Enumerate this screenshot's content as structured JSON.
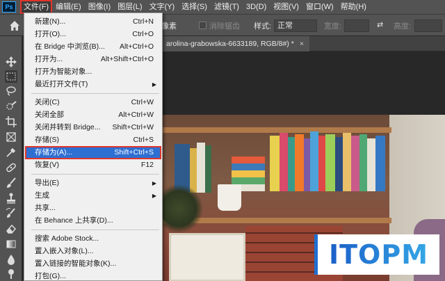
{
  "menubar": {
    "logo": "Ps",
    "items": [
      "文件(F)",
      "编辑(E)",
      "图像(I)",
      "图层(L)",
      "文字(Y)",
      "选择(S)",
      "滤镜(T)",
      "3D(D)",
      "视图(V)",
      "窗口(W)",
      "帮助(H)"
    ]
  },
  "options": {
    "unit": "像素",
    "antialias": "消除锯齿",
    "style_label": "样式:",
    "style_value": "正常",
    "width_label": "宽度:",
    "height_label": "高度:"
  },
  "document_tab": {
    "title": "arolina-grabowska-6633189, RGB/8#) *",
    "close": "×"
  },
  "file_menu": {
    "items": [
      {
        "label": "新建(N)...",
        "shortcut": "Ctrl+N"
      },
      {
        "label": "打开(O)...",
        "shortcut": "Ctrl+O"
      },
      {
        "label": "在 Bridge 中浏览(B)...",
        "shortcut": "Alt+Ctrl+O"
      },
      {
        "label": "打开为...",
        "shortcut": "Alt+Shift+Ctrl+O"
      },
      {
        "label": "打开为智能对象...",
        "shortcut": ""
      },
      {
        "label": "最近打开文件(T)",
        "shortcut": "",
        "submenu": true
      },
      {
        "label": "关闭(C)",
        "shortcut": "Ctrl+W"
      },
      {
        "label": "关闭全部",
        "shortcut": "Alt+Ctrl+W"
      },
      {
        "label": "关闭并转到 Bridge...",
        "shortcut": "Shift+Ctrl+W"
      },
      {
        "label": "存储(S)",
        "shortcut": "Ctrl+S"
      },
      {
        "label": "存储为(A)...",
        "shortcut": "Shift+Ctrl+S",
        "highlighted": true
      },
      {
        "label": "恢复(V)",
        "shortcut": "F12"
      },
      {
        "label": "导出(E)",
        "shortcut": "",
        "submenu": true
      },
      {
        "label": "生成",
        "shortcut": "",
        "submenu": true
      },
      {
        "label": "共享...",
        "shortcut": ""
      },
      {
        "label": "在 Behance 上共享(D)...",
        "shortcut": ""
      },
      {
        "label": "搜索 Adobe Stock...",
        "shortcut": ""
      },
      {
        "label": "置入嵌入对象(L)...",
        "shortcut": ""
      },
      {
        "label": "置入链接的智能对象(K)...",
        "shortcut": ""
      },
      {
        "label": "打包(G)...",
        "shortcut": ""
      }
    ],
    "submenu_arrow": "▶"
  },
  "watermark": "ITOPM",
  "colors": {
    "highlight": "#2e6fd2",
    "red_outline": "#e0352b",
    "ui_panel": "#535353"
  },
  "icons": [
    "home-icon",
    "move-tool-icon",
    "marquee-tool-icon",
    "lasso-tool-icon",
    "quick-select-icon",
    "crop-tool-icon",
    "frame-tool-icon",
    "eyedropper-icon",
    "healing-brush-icon",
    "brush-tool-icon",
    "clone-stamp-icon",
    "history-brush-icon",
    "eraser-icon",
    "gradient-icon",
    "blur-icon",
    "dodge-icon"
  ]
}
